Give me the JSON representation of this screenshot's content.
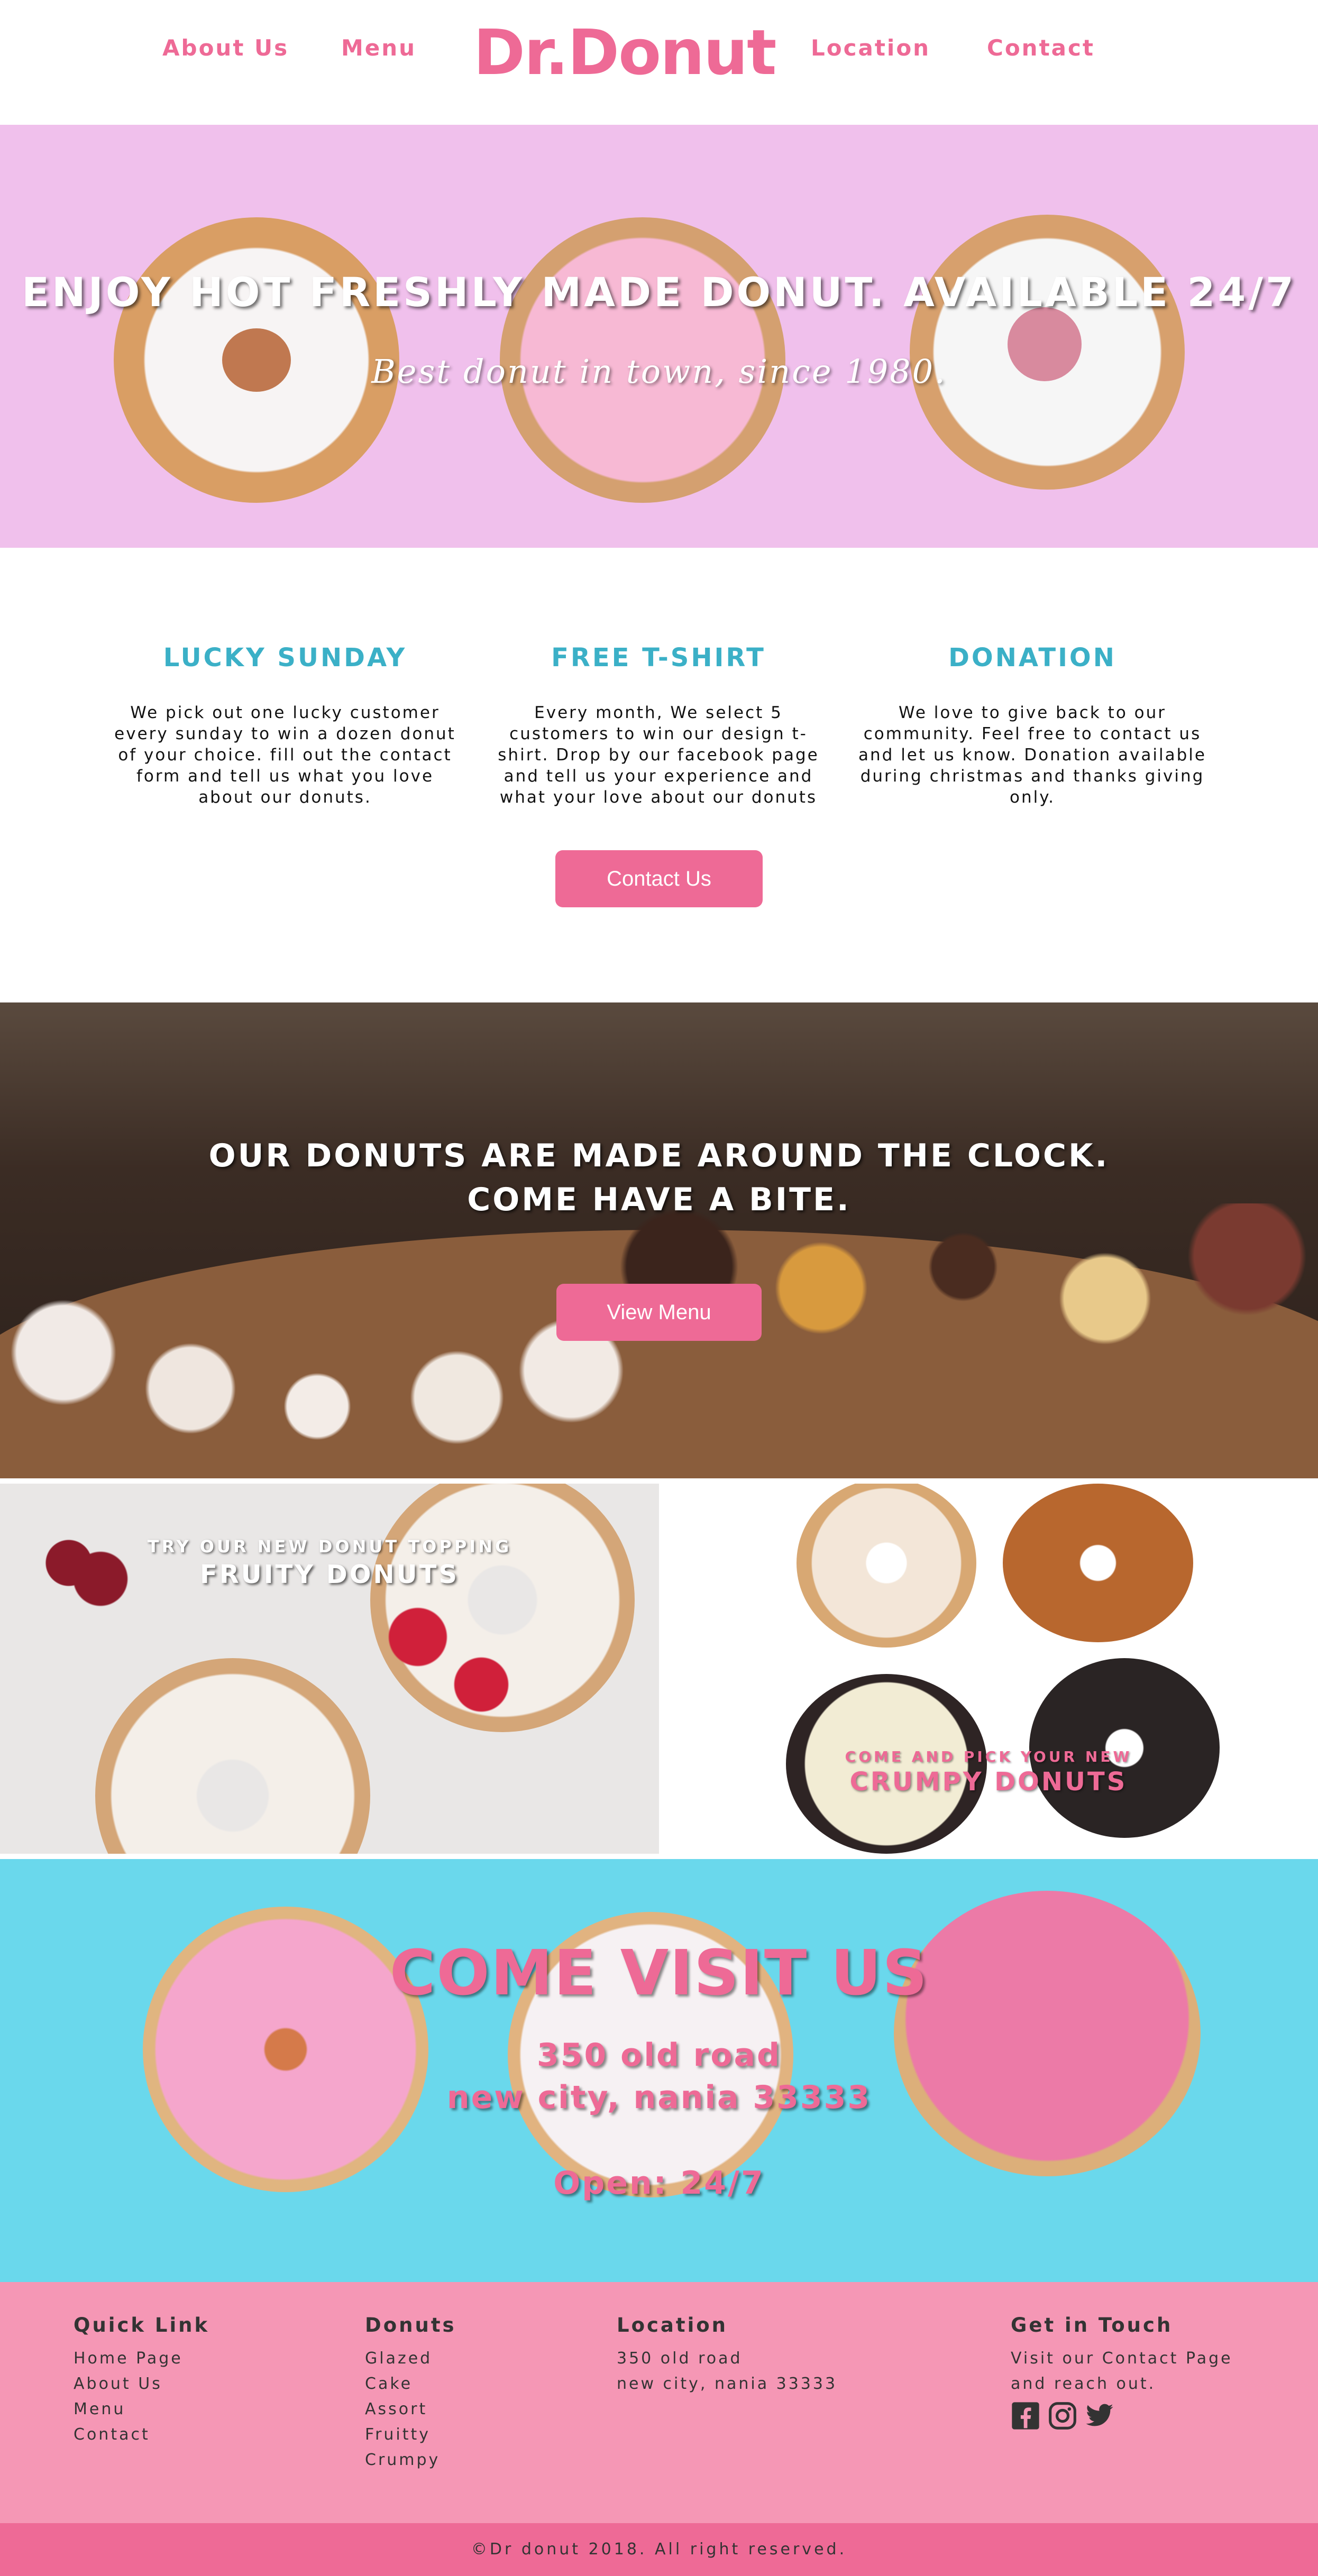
{
  "nav": {
    "links": [
      "About Us",
      "Menu",
      "Location",
      "Contact"
    ],
    "brand": "Dr.Donut"
  },
  "hero": {
    "title": "ENJOY HOT FRESHLY MADE DONUT. AVAILABLE 24/7",
    "subtitle": "Best donut in town, since 1980."
  },
  "features": [
    {
      "title": "LUCKY SUNDAY",
      "text": "We pick out one lucky customer every sunday to win a dozen donut of your choice. fill out the contact form and tell us what you love about our donuts."
    },
    {
      "title": "FREE T-SHIRT",
      "text": "Every month, We select 5 customers to win our design t-shirt. Drop by our facebook page and tell us your experience and what your love about our donuts"
    },
    {
      "title": "DONATION",
      "text": "We love to give back to our community. Feel free to contact us and let us know. Donation available during christmas and thanks giving only."
    }
  ],
  "contact_button": "Contact Us",
  "showcase": {
    "line1": "OUR DONUTS ARE MADE AROUND THE CLOCK.",
    "line2": "COME HAVE A BITE.",
    "button": "View Menu"
  },
  "tiles": {
    "fruity": {
      "small": "TRY OUR NEW DONUT TOPPING",
      "big": "FRUITY DONUTS"
    },
    "crumpy": {
      "small": "COME AND PICK YOUR NEW",
      "big": "CRUMPY DONUTS"
    }
  },
  "visit": {
    "title": "COME VISIT US",
    "address1": "350 old road",
    "address2": "new city, nania 33333",
    "hours": "Open: 24/7"
  },
  "footer": {
    "quick": {
      "title": "Quick Link",
      "items": [
        "Home Page",
        "About Us",
        "Menu",
        "Contact"
      ]
    },
    "donuts": {
      "title": "Donuts",
      "items": [
        "Glazed",
        "Cake",
        "Assort",
        "Fruitty",
        "Crumpy"
      ]
    },
    "location": {
      "title": "Location",
      "items": [
        "350 old road",
        "new city, nania 33333"
      ]
    },
    "touch": {
      "title": "Get in Touch",
      "items": [
        "Visit our Contact Page",
        "and reach out."
      ]
    },
    "copyright": "©Dr donut 2018. All right reserved."
  },
  "icons": [
    "facebook-icon",
    "instagram-icon",
    "twitter-icon"
  ],
  "colors": {
    "brand_pink": "#ee6a96",
    "teal": "#3bb0c7",
    "hero_bg": "#f0c0ec",
    "visit_bg": "#6ad8ec",
    "footer_bg": "#f597b5"
  }
}
